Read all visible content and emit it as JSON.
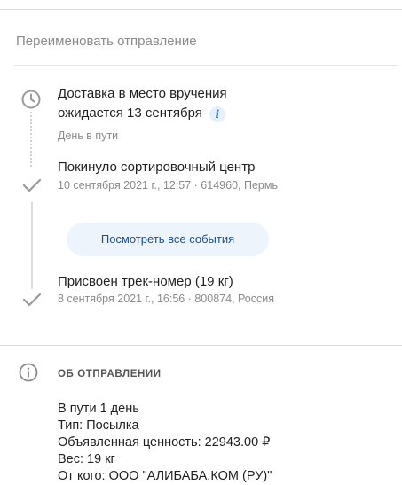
{
  "rename_label": "Переименовать отправление",
  "events": [
    {
      "title_line1": "Доставка в место вручения",
      "title_line2": "ожидается 13 сентября",
      "subtitle": "День в пути",
      "icon": "clock-icon"
    },
    {
      "title": "Покинуло сортировочный центр",
      "subtitle": "10 сентября 2021 г., 12:57 · 614960, Пермь",
      "icon": "check-icon"
    },
    {
      "title": "Присвоен трек-номер (19 кг)",
      "subtitle": "8 сентября 2021 г., 16:56 · 800874, Россия",
      "icon": "check-icon"
    }
  ],
  "info_badge": "i",
  "view_all_events_label": "Посмотреть все события",
  "about": {
    "title": "ОБ ОТПРАВЛЕНИИ",
    "lines": [
      "В пути 1 день",
      "Тип: Посылка",
      "Объявленная ценность: 22943.00 ₽",
      "Вес: 19 кг",
      "От кого: ООО \"АЛИБАБА.КОМ (РУ)\""
    ]
  },
  "colors": {
    "accent": "#1a4f8c",
    "button_bg": "#eef4fc",
    "muted": "#8a8a8a"
  }
}
